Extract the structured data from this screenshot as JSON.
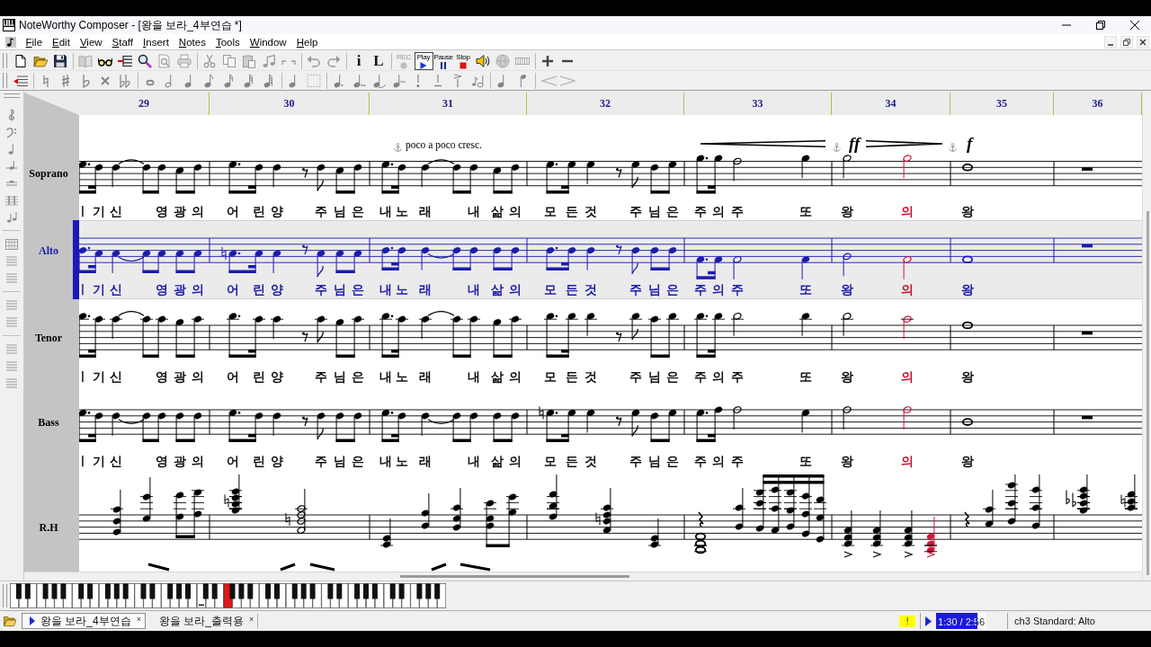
{
  "window": {
    "title": "NoteWorthy Composer - [왕을 보라_4부연습 *]"
  },
  "menu": [
    {
      "label": "File"
    },
    {
      "label": "Edit"
    },
    {
      "label": "View"
    },
    {
      "label": "Staff"
    },
    {
      "label": "Insert"
    },
    {
      "label": "Notes"
    },
    {
      "label": "Tools"
    },
    {
      "label": "Window"
    },
    {
      "label": "Help"
    }
  ],
  "toolbar_main": [
    {
      "disabled": false,
      "pressed": false
    },
    {
      "disabled": false,
      "pressed": false
    },
    {
      "disabled": false,
      "pressed": false
    },
    {
      "disabled": true,
      "pressed": false
    },
    {
      "disabled": false,
      "pressed": false
    },
    {
      "disabled": false,
      "pressed": false
    },
    {
      "disabled": false,
      "pressed": false
    },
    {
      "disabled": true,
      "pressed": false
    },
    {
      "disabled": true,
      "pressed": false
    },
    {
      "disabled": true,
      "pressed": false
    },
    {
      "disabled": true,
      "pressed": false
    },
    {
      "disabled": true,
      "pressed": false
    },
    {
      "disabled": true,
      "pressed": false
    },
    {
      "disabled": true,
      "pressed": false
    },
    {
      "disabled": true,
      "pressed": false
    },
    {
      "disabled": true,
      "pressed": false
    },
    {
      "label": "i",
      "disabled": false,
      "pressed": false
    },
    {
      "label": "L",
      "disabled": false,
      "pressed": false
    },
    {
      "label": "REC",
      "disabled": true,
      "pressed": false
    },
    {
      "label": "Play",
      "disabled": false,
      "pressed": true
    },
    {
      "label": "Pause",
      "disabled": false,
      "pressed": false
    },
    {
      "label": "Stop",
      "disabled": false,
      "pressed": false
    },
    {
      "disabled": false,
      "pressed": false
    },
    {
      "disabled": true,
      "pressed": false
    },
    {
      "disabled": true,
      "pressed": false
    },
    {
      "disabled": false,
      "pressed": false
    },
    {
      "disabled": false,
      "pressed": false
    }
  ],
  "toolbar_notes": [
    {
      "disabled": false
    },
    {
      "disabled": true
    },
    {
      "disabled": true
    },
    {
      "disabled": true
    },
    {
      "disabled": true
    },
    {
      "disabled": true
    },
    {
      "disabled": true
    },
    {
      "disabled": true
    },
    {
      "disabled": true
    },
    {
      "disabled": true
    },
    {
      "disabled": true
    },
    {
      "disabled": true
    },
    {
      "disabled": true
    },
    {
      "disabled": true
    },
    {
      "disabled": true
    },
    {
      "disabled": true
    },
    {
      "disabled": true
    },
    {
      "disabled": true
    },
    {
      "disabled": true
    },
    {
      "disabled": true
    },
    {
      "disabled": true
    },
    {
      "disabled": true
    },
    {
      "disabled": true
    },
    {
      "disabled": true
    },
    {
      "disabled": true
    },
    {
      "disabled": true
    }
  ],
  "measure_numbers": [
    "29",
    "30",
    "31",
    "32",
    "33",
    "34",
    "35",
    "36"
  ],
  "staves": [
    {
      "kind": "vocal",
      "name": "Soprano",
      "selected": false,
      "expressions": [
        {
          "kind": "text",
          "text": "poco a poco cresc."
        },
        {
          "kind": "crescendo"
        },
        {
          "kind": "dynamic",
          "text": "ff"
        },
        {
          "kind": "diminuendo"
        },
        {
          "kind": "dynamic",
          "text": "f"
        }
      ],
      "lyrics": [
        [
          {
            "text": "ㅣ",
            "playing": false
          },
          {
            "text": "기",
            "playing": false
          },
          {
            "text": "신",
            "playing": false
          },
          {
            "text": "영",
            "playing": false
          },
          {
            "text": "광",
            "playing": false
          },
          {
            "text": "의",
            "playing": false
          }
        ],
        [
          {
            "text": "어",
            "playing": false
          },
          {
            "text": "린",
            "playing": false
          },
          {
            "text": "양",
            "playing": false
          },
          {
            "text": "주",
            "playing": false
          },
          {
            "text": "님",
            "playing": false
          },
          {
            "text": "은",
            "playing": false
          }
        ],
        [
          {
            "text": "내",
            "playing": false
          },
          {
            "text": "노",
            "playing": false
          },
          {
            "text": "래",
            "playing": false
          },
          {
            "text": "내",
            "playing": false
          },
          {
            "text": "삶",
            "playing": false
          },
          {
            "text": "의",
            "playing": false
          }
        ],
        [
          {
            "text": "모",
            "playing": false
          },
          {
            "text": "든",
            "playing": false
          },
          {
            "text": "것",
            "playing": false
          },
          {
            "text": "주",
            "playing": false
          },
          {
            "text": "님",
            "playing": false
          },
          {
            "text": "은",
            "playing": false
          }
        ],
        [
          {
            "text": "주",
            "playing": false
          },
          {
            "text": "의",
            "playing": false
          },
          {
            "text": "주",
            "playing": false
          },
          {
            "text": "또",
            "playing": false
          }
        ],
        [
          {
            "text": "왕",
            "playing": false
          },
          {
            "text": "의",
            "playing": true
          }
        ],
        [
          {
            "text": "왕",
            "playing": false
          }
        ]
      ]
    },
    {
      "kind": "vocal",
      "name": "Alto",
      "selected": true,
      "lyrics": [
        [
          {
            "text": "ㅣ",
            "playing": false
          },
          {
            "text": "기",
            "playing": false
          },
          {
            "text": "신",
            "playing": false
          },
          {
            "text": "영",
            "playing": false
          },
          {
            "text": "광",
            "playing": false
          },
          {
            "text": "의",
            "playing": false
          }
        ],
        [
          {
            "text": "어",
            "playing": false
          },
          {
            "text": "린",
            "playing": false
          },
          {
            "text": "양",
            "playing": false
          },
          {
            "text": "주",
            "playing": false
          },
          {
            "text": "님",
            "playing": false
          },
          {
            "text": "은",
            "playing": false
          }
        ],
        [
          {
            "text": "내",
            "playing": false
          },
          {
            "text": "노",
            "playing": false
          },
          {
            "text": "래",
            "playing": false
          },
          {
            "text": "내",
            "playing": false
          },
          {
            "text": "삶",
            "playing": false
          },
          {
            "text": "의",
            "playing": false
          }
        ],
        [
          {
            "text": "모",
            "playing": false
          },
          {
            "text": "든",
            "playing": false
          },
          {
            "text": "것",
            "playing": false
          },
          {
            "text": "주",
            "playing": false
          },
          {
            "text": "님",
            "playing": false
          },
          {
            "text": "은",
            "playing": false
          }
        ],
        [
          {
            "text": "주",
            "playing": false
          },
          {
            "text": "의",
            "playing": false
          },
          {
            "text": "주",
            "playing": false
          },
          {
            "text": "또",
            "playing": false
          }
        ],
        [
          {
            "text": "왕",
            "playing": false
          },
          {
            "text": "의",
            "playing": true
          }
        ],
        [
          {
            "text": "왕",
            "playing": false
          }
        ]
      ]
    },
    {
      "kind": "vocal",
      "name": "Tenor",
      "selected": false,
      "lyrics": [
        [
          {
            "text": "ㅣ",
            "playing": false
          },
          {
            "text": "기",
            "playing": false
          },
          {
            "text": "신",
            "playing": false
          },
          {
            "text": "영",
            "playing": false
          },
          {
            "text": "광",
            "playing": false
          },
          {
            "text": "의",
            "playing": false
          }
        ],
        [
          {
            "text": "어",
            "playing": false
          },
          {
            "text": "린",
            "playing": false
          },
          {
            "text": "양",
            "playing": false
          },
          {
            "text": "주",
            "playing": false
          },
          {
            "text": "님",
            "playing": false
          },
          {
            "text": "은",
            "playing": false
          }
        ],
        [
          {
            "text": "내",
            "playing": false
          },
          {
            "text": "노",
            "playing": false
          },
          {
            "text": "래",
            "playing": false
          },
          {
            "text": "내",
            "playing": false
          },
          {
            "text": "삶",
            "playing": false
          },
          {
            "text": "의",
            "playing": false
          }
        ],
        [
          {
            "text": "모",
            "playing": false
          },
          {
            "text": "든",
            "playing": false
          },
          {
            "text": "것",
            "playing": false
          },
          {
            "text": "주",
            "playing": false
          },
          {
            "text": "님",
            "playing": false
          },
          {
            "text": "은",
            "playing": false
          }
        ],
        [
          {
            "text": "주",
            "playing": false
          },
          {
            "text": "의",
            "playing": false
          },
          {
            "text": "주",
            "playing": false
          },
          {
            "text": "또",
            "playing": false
          }
        ],
        [
          {
            "text": "왕",
            "playing": false
          },
          {
            "text": "의",
            "playing": true
          }
        ],
        [
          {
            "text": "왕",
            "playing": false
          }
        ]
      ]
    },
    {
      "kind": "vocal",
      "name": "Bass",
      "selected": false,
      "lyrics": [
        [
          {
            "text": "ㅣ",
            "playing": false
          },
          {
            "text": "기",
            "playing": false
          },
          {
            "text": "신",
            "playing": false
          },
          {
            "text": "영",
            "playing": false
          },
          {
            "text": "광",
            "playing": false
          },
          {
            "text": "의",
            "playing": false
          }
        ],
        [
          {
            "text": "어",
            "playing": false
          },
          {
            "text": "린",
            "playing": false
          },
          {
            "text": "양",
            "playing": false
          },
          {
            "text": "주",
            "playing": false
          },
          {
            "text": "님",
            "playing": false
          },
          {
            "text": "은",
            "playing": false
          }
        ],
        [
          {
            "text": "내",
            "playing": false
          },
          {
            "text": "노",
            "playing": false
          },
          {
            "text": "래",
            "playing": false
          },
          {
            "text": "내",
            "playing": false
          },
          {
            "text": "삶",
            "playing": false
          },
          {
            "text": "의",
            "playing": false
          }
        ],
        [
          {
            "text": "모",
            "playing": false
          },
          {
            "text": "든",
            "playing": false
          },
          {
            "text": "것",
            "playing": false
          },
          {
            "text": "주",
            "playing": false
          },
          {
            "text": "님",
            "playing": false
          },
          {
            "text": "은",
            "playing": false
          }
        ],
        [
          {
            "text": "주",
            "playing": false
          },
          {
            "text": "의",
            "playing": false
          },
          {
            "text": "주",
            "playing": false
          },
          {
            "text": "또",
            "playing": false
          }
        ],
        [
          {
            "text": "왕",
            "playing": false
          },
          {
            "text": "의",
            "playing": true
          }
        ],
        [
          {
            "text": "왕",
            "playing": false
          }
        ]
      ]
    },
    {
      "kind": "piano",
      "name": "R.H",
      "selected": false,
      "chords": [
        {
          "playing": false
        },
        {
          "playing": false
        },
        {
          "playing": false
        },
        {
          "playing": false
        },
        {
          "playing": false
        },
        {
          "playing": false
        },
        {
          "playing": false
        },
        {
          "playing": false
        },
        {
          "playing": false
        },
        {
          "playing": false
        },
        {
          "playing": false
        },
        {
          "playing": false
        },
        {
          "playing": false
        },
        {
          "playing": false
        },
        {
          "playing": false
        },
        {
          "playing": false
        },
        {
          "playing": false
        },
        {
          "playing": false
        },
        {
          "playing": false
        },
        {
          "playing": false
        },
        {
          "playing": false
        },
        {
          "playing": false
        },
        {
          "playing": false
        },
        {
          "playing": false
        },
        {
          "playing": true
        },
        {
          "playing": false
        },
        {
          "playing": false
        },
        {
          "playing": false
        },
        {
          "playing": false
        },
        {
          "playing": false
        }
      ]
    }
  ],
  "piano_keyboard": {
    "white_keys": [
      {
        "pressed": false
      },
      {
        "pressed": false
      },
      {
        "pressed": false
      },
      {
        "pressed": false
      },
      {
        "pressed": false
      },
      {
        "pressed": false
      },
      {
        "pressed": false
      },
      {
        "pressed": false
      },
      {
        "pressed": false
      },
      {
        "pressed": false
      },
      {
        "pressed": false
      },
      {
        "pressed": false
      },
      {
        "pressed": false
      },
      {
        "pressed": false
      },
      {
        "pressed": false
      },
      {
        "pressed": false
      },
      {
        "pressed": false
      },
      {
        "pressed": false
      },
      {
        "pressed": false
      },
      {
        "pressed": false
      },
      {
        "pressed": false
      },
      {
        "pressed": false
      },
      {
        "pressed": false
      },
      {
        "pressed": false
      },
      {
        "pressed": true
      },
      {
        "pressed": false
      },
      {
        "pressed": false
      },
      {
        "pressed": false
      },
      {
        "pressed": false
      },
      {
        "pressed": false
      },
      {
        "pressed": false
      },
      {
        "pressed": false
      },
      {
        "pressed": false
      },
      {
        "pressed": false
      },
      {
        "pressed": false
      },
      {
        "pressed": false
      },
      {
        "pressed": false
      },
      {
        "pressed": false
      },
      {
        "pressed": false
      },
      {
        "pressed": false
      },
      {
        "pressed": false
      },
      {
        "pressed": false
      },
      {
        "pressed": false
      },
      {
        "pressed": false
      },
      {
        "pressed": false
      },
      {
        "pressed": false
      },
      {
        "pressed": false
      },
      {
        "pressed": false
      },
      {
        "pressed": false
      }
    ],
    "black_keys": [
      {
        "pressed": false
      },
      {
        "pressed": false
      },
      {
        "pressed": false
      },
      {
        "pressed": false
      },
      {
        "pressed": false
      },
      {
        "pressed": false
      },
      {
        "pressed": false
      },
      {
        "pressed": false
      },
      {
        "pressed": false
      },
      {
        "pressed": false
      },
      {
        "pressed": false
      },
      {
        "pressed": false
      },
      {
        "pressed": false
      },
      {
        "pressed": false
      },
      {
        "pressed": false
      },
      {
        "pressed": false
      },
      {
        "pressed": false
      },
      {
        "pressed": false
      },
      {
        "pressed": false
      },
      {
        "pressed": false
      },
      {
        "pressed": false
      },
      {
        "pressed": false
      },
      {
        "pressed": false
      },
      {
        "pressed": false
      },
      {
        "pressed": false
      },
      {
        "pressed": false
      },
      {
        "pressed": false
      },
      {
        "pressed": false
      },
      {
        "pressed": false
      },
      {
        "pressed": false
      },
      {
        "pressed": false
      },
      {
        "pressed": false
      },
      {
        "pressed": false
      },
      {
        "pressed": false
      },
      {
        "pressed": false
      }
    ]
  },
  "document_tabs": [
    {
      "label": "왕을 보라_4부연습",
      "selected": true,
      "close": "×"
    },
    {
      "label": "왕을 보라_출력용",
      "selected": false,
      "close": "×"
    }
  ],
  "status_bar": {
    "warning": "!",
    "playing": true,
    "time": {
      "text": "1:30 / 2:56",
      "level": 0.82
    },
    "channel": "ch3 Standard: Alto"
  }
}
